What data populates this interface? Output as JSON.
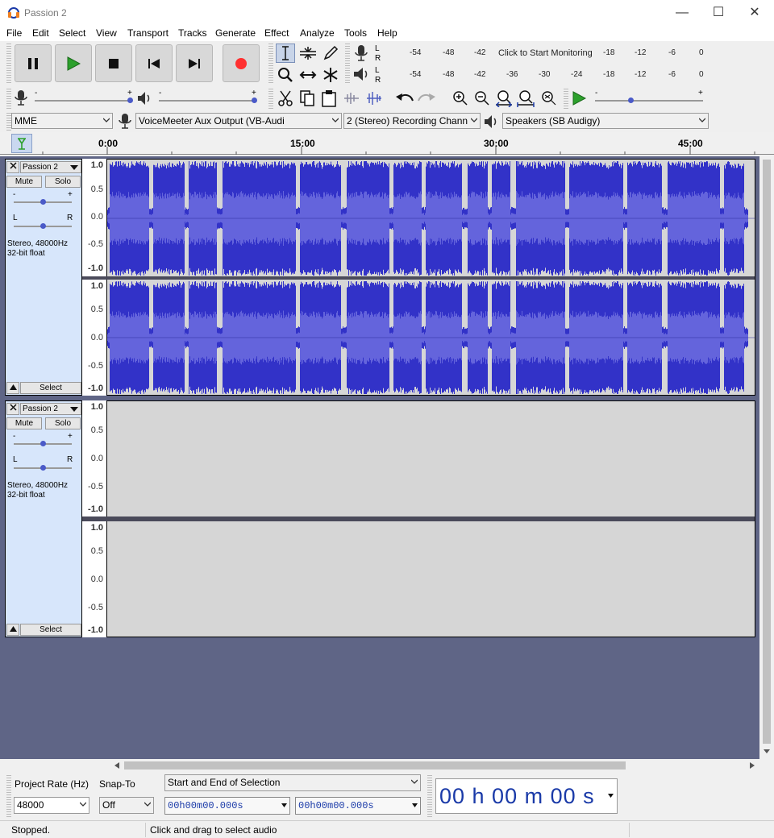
{
  "window": {
    "title": "Passion 2",
    "minimize": "—",
    "maximize": "☐",
    "close": "✕"
  },
  "menu": [
    "File",
    "Edit",
    "Select",
    "View",
    "Transport",
    "Tracks",
    "Generate",
    "Effect",
    "Analyze",
    "Tools",
    "Help"
  ],
  "meters": {
    "rec_lr": [
      "L",
      "R"
    ],
    "play_lr": [
      "L",
      "R"
    ],
    "rec_ticks": [
      "-54",
      "-48",
      "-42",
      "-18",
      "-12",
      "-6",
      "0"
    ],
    "rec_monitor_text": "Click to Start Monitoring",
    "play_ticks": [
      "-54",
      "-48",
      "-42",
      "-36",
      "-30",
      "-24",
      "-18",
      "-12",
      "-6",
      "0"
    ]
  },
  "mixer": {
    "minus": "-",
    "plus": "+"
  },
  "device": {
    "host": "MME",
    "recording_device": "VoiceMeeter Aux Output (VB-Audi",
    "recording_channels": "2 (Stereo) Recording Chann",
    "playback_device": "Speakers (SB Audigy)"
  },
  "timeline": {
    "ticks": [
      "0:00",
      "15:00",
      "30:00",
      "45:00"
    ]
  },
  "tracks": [
    {
      "name": "Passion 2",
      "mute": "Mute",
      "solo": "Solo",
      "gain_minus": "-",
      "gain_plus": "+",
      "pan_left": "L",
      "pan_right": "R",
      "info1": "Stereo, 48000Hz",
      "info2": "32-bit float",
      "select": "Select",
      "scale": [
        "1.0",
        "0.5",
        "0.0",
        "-0.5",
        "-1.0"
      ],
      "has_audio": true
    },
    {
      "name": "Passion 2",
      "mute": "Mute",
      "solo": "Solo",
      "gain_minus": "-",
      "gain_plus": "+",
      "pan_left": "L",
      "pan_right": "R",
      "info1": "Stereo, 48000Hz",
      "info2": "32-bit float",
      "select": "Select",
      "scale": [
        "1.0",
        "0.5",
        "0.0",
        "-0.5",
        "-1.0"
      ],
      "has_audio": false
    }
  ],
  "selection_bar": {
    "project_rate_label": "Project Rate (Hz)",
    "project_rate": "48000",
    "snap_to_label": "Snap-To",
    "snap_to": "Off",
    "selection_mode": "Start and End of Selection",
    "start_time": "00h00m00.000s",
    "end_time": "00h00m00.000s",
    "audio_position": "00 h 00 m 00 s"
  },
  "status": {
    "state": "Stopped.",
    "hint": "Click and drag to select audio"
  },
  "colors": {
    "waveform": "#3232c8",
    "waveform_rms": "#6464dc",
    "track_bg": "#d6d6d6",
    "panel_bg": "#d7e6fb",
    "tracks_area": "#5f6586",
    "record": "#ff3030",
    "play": "#2ca02c"
  }
}
